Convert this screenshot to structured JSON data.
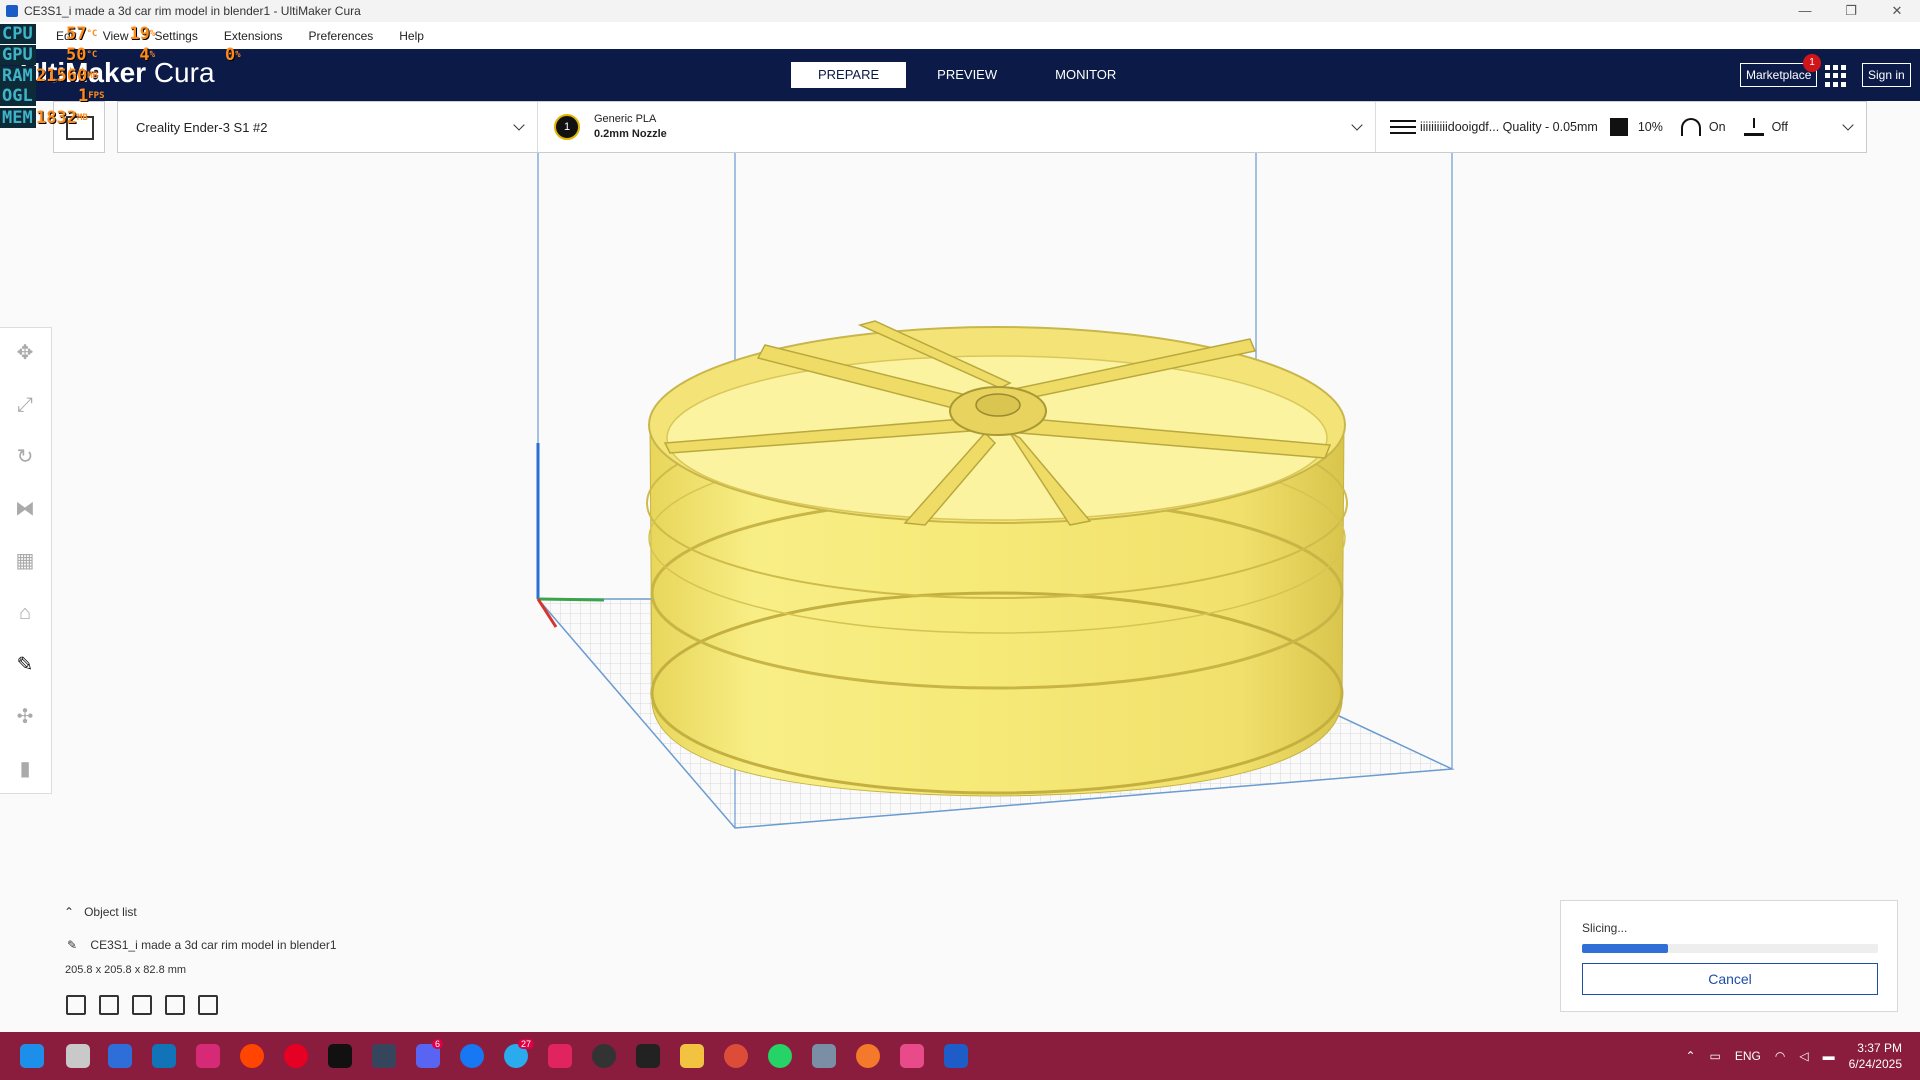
{
  "window": {
    "title": "CE3S1_i made a 3d car rim model in blender1 - UltiMaker Cura",
    "controls": [
      "—",
      "❐",
      "✕"
    ]
  },
  "menu": [
    "Edit",
    "View",
    "Settings",
    "Extensions",
    "Preferences",
    "Help"
  ],
  "overlay": [
    {
      "label": "CPU",
      "value": "57",
      "unit": "°C",
      "value2": "19",
      "unit2": "%"
    },
    {
      "label": "GPU",
      "value": "50",
      "unit": "°C",
      "value2": "4",
      "unit2": "%",
      "value3": "0",
      "unit3": "%"
    },
    {
      "label": "RAM",
      "value": "21560",
      "unit": "MB"
    },
    {
      "label": "OGL",
      "value": "1",
      "unit": "FPS"
    },
    {
      "label": "MEM",
      "value": "1832",
      "unit": "MB"
    }
  ],
  "header": {
    "logo_bold": "UltiMaker",
    "logo_thin": "Cura",
    "tabs": [
      "PREPARE",
      "PREVIEW",
      "MONITOR"
    ],
    "active_tab": "PREPARE",
    "marketplace": "Marketplace",
    "marketplace_badge": "1",
    "signin": "Sign in"
  },
  "printer": {
    "machine": "Creality Ender-3 S1 #2",
    "extruder_number": "1",
    "material": "Generic PLA",
    "nozzle": "0.2mm Nozzle",
    "profile": "iiiiiiiiiidooigdf... Quality - 0.05mm",
    "infill": "10%",
    "support": "On",
    "adhesion": "Off"
  },
  "objects": {
    "header": "Object list",
    "item": "CE3S1_i made a 3d car rim model in blender1",
    "dimensions": "205.8 x 205.8 x 82.8 mm"
  },
  "slicing": {
    "status": "Slicing...",
    "progress": 0.29,
    "cancel": "Cancel"
  },
  "taskbar": {
    "telegram_badge": "27",
    "discord_badge": "6",
    "language": "ENG",
    "time": "3:37 PM",
    "date": "6/24/2025"
  },
  "colors": {
    "header_bg": "#0c1a47",
    "model_yellow": "#f5e872",
    "taskbar_bg": "#8a1c3e",
    "accent_blue": "#2f6fd6"
  }
}
